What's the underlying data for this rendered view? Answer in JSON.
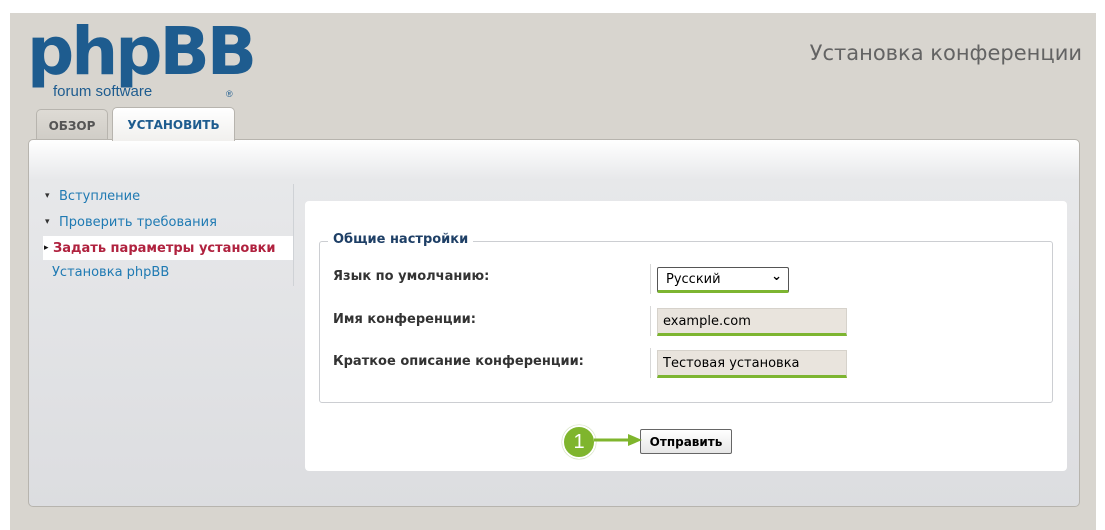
{
  "header": {
    "logo_main": "phpBB",
    "logo_sub": "forum  software",
    "logo_reg": "®",
    "title": "Установка конференции"
  },
  "tabs": [
    {
      "label": "ОБЗОР",
      "active": false
    },
    {
      "label": "УСТАНОВИТЬ",
      "active": true
    }
  ],
  "menu": {
    "items": [
      {
        "label": "Вступление",
        "state": "done"
      },
      {
        "label": "Проверить требования",
        "state": "done"
      },
      {
        "label": "Задать параметры установки",
        "state": "active"
      },
      {
        "label": "Установка phpBB",
        "state": "pending"
      }
    ]
  },
  "form": {
    "legend": "Общие настройки",
    "fields": [
      {
        "label": "Язык по умолчанию:",
        "value": "Русский"
      },
      {
        "label": "Имя конференции:",
        "value": "example.com"
      },
      {
        "label": "Краткое описание конференции:",
        "value": "Тестовая установка"
      }
    ],
    "submit_label": "Отправить"
  },
  "callout": {
    "number": "1"
  },
  "colors": {
    "accent_green": "#7db531",
    "brand_blue": "#1e5c8f",
    "active_red": "#b0223f",
    "link_blue": "#1f7ab3"
  }
}
